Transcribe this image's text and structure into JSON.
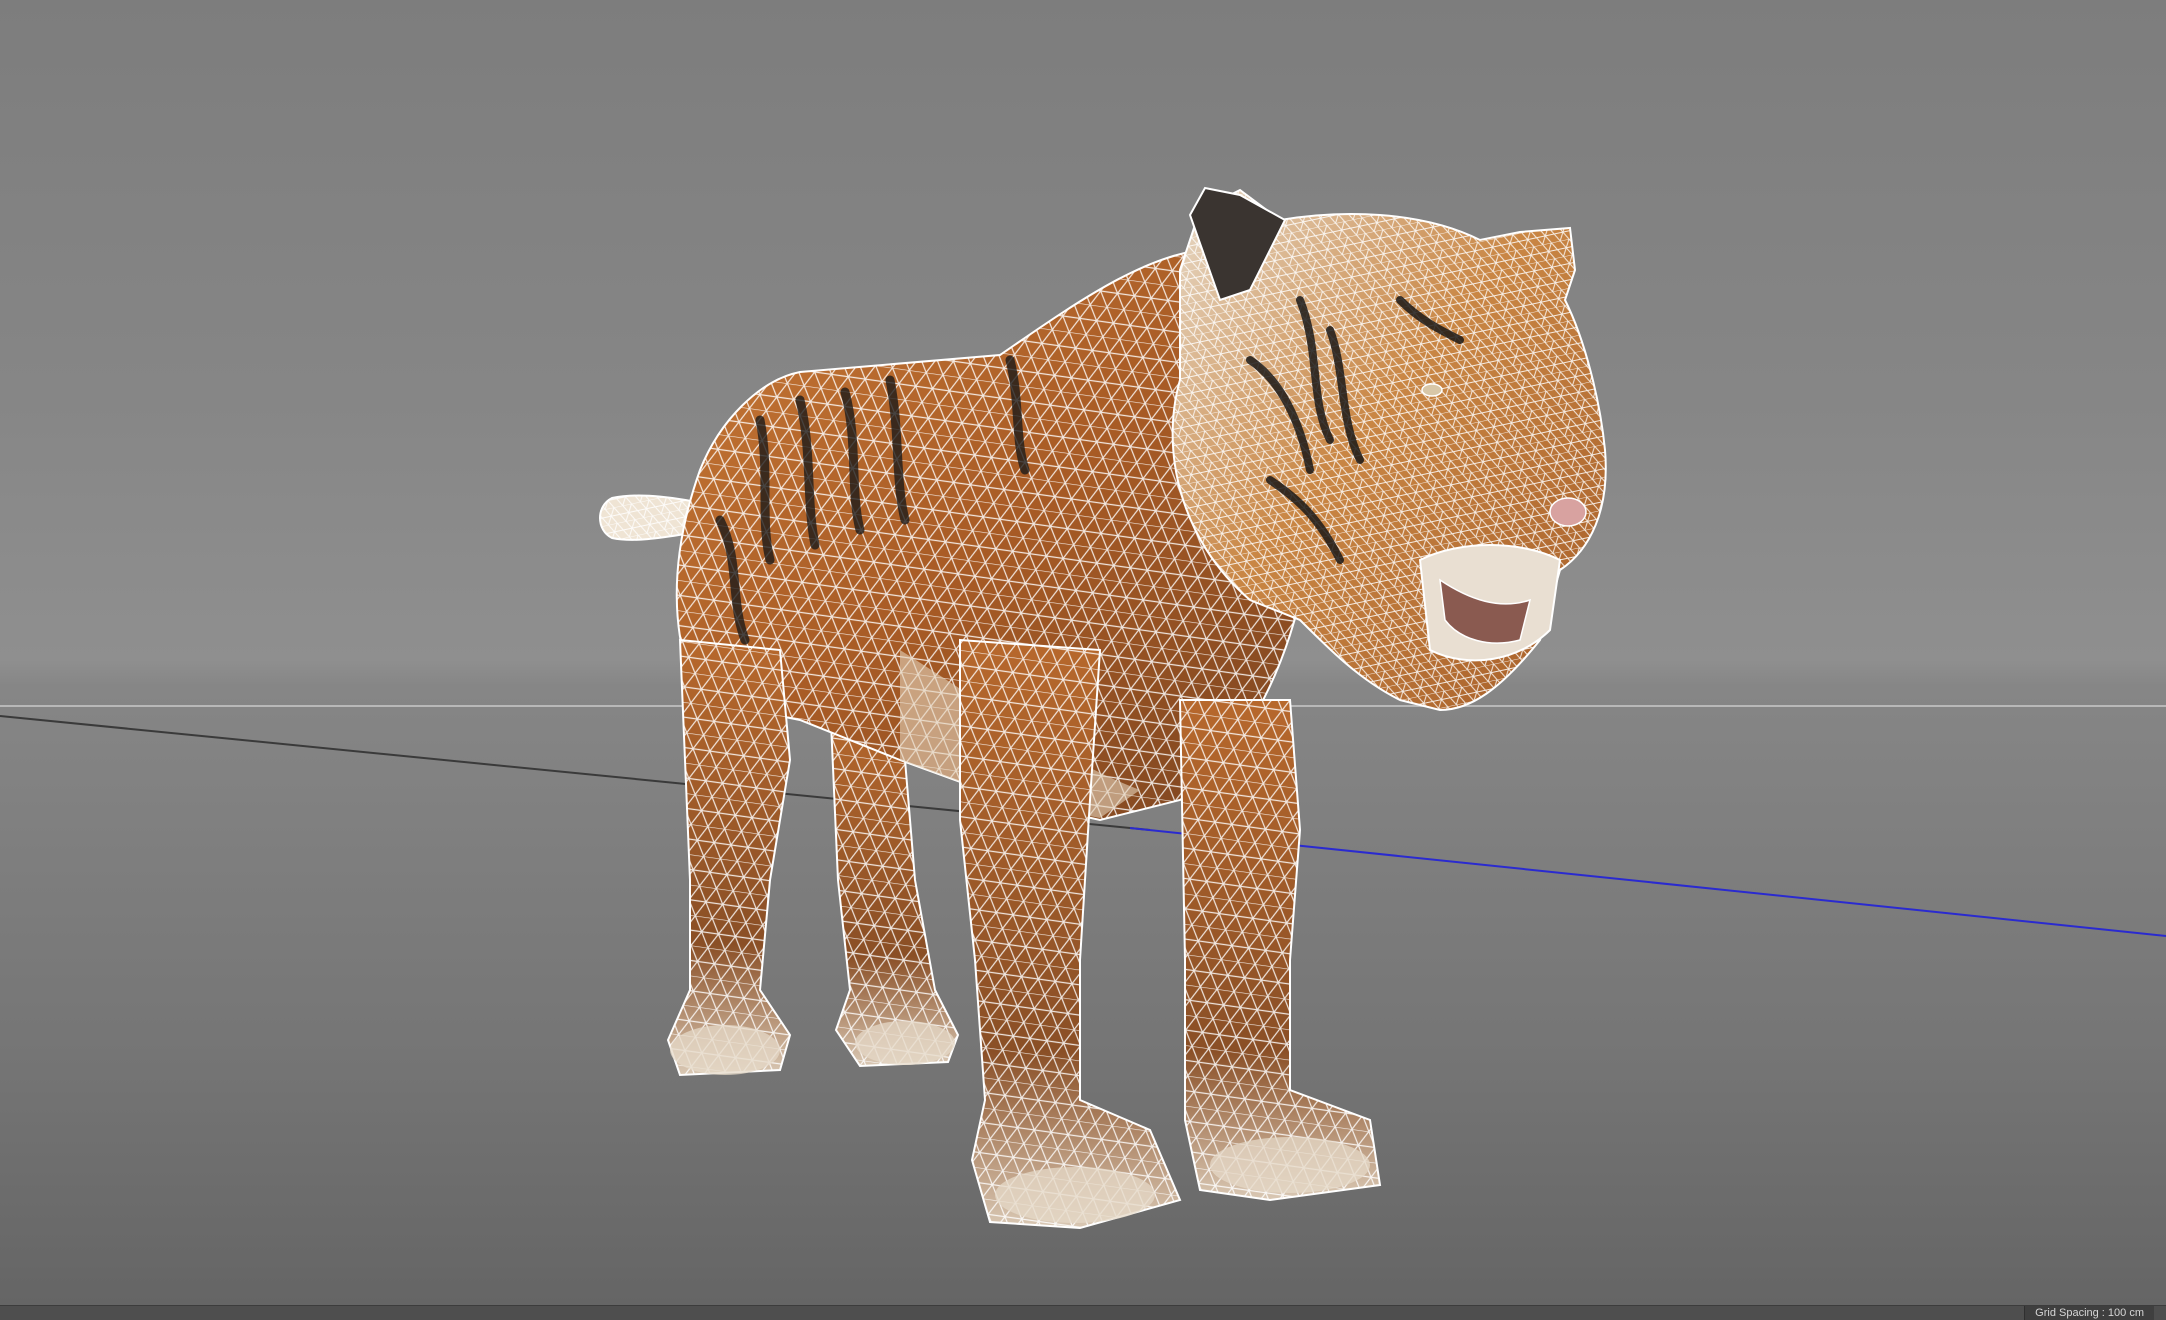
{
  "viewport": {
    "background_top": "#7d7d7d",
    "background_bottom": "#646464",
    "horizon_line_color": "#b8b8b8",
    "x_axis_color": "#3a3a3a",
    "z_axis_color": "#2a2ad0"
  },
  "model": {
    "render_mode": "wireframe-on-shaded",
    "wire_color": "#ffffff",
    "fur_base": "#b86a2c",
    "fur_light": "#e8d7c1",
    "stripe_color": "#1d1b1a"
  },
  "statusbar": {
    "readout": "Grid Spacing : 100 cm"
  }
}
